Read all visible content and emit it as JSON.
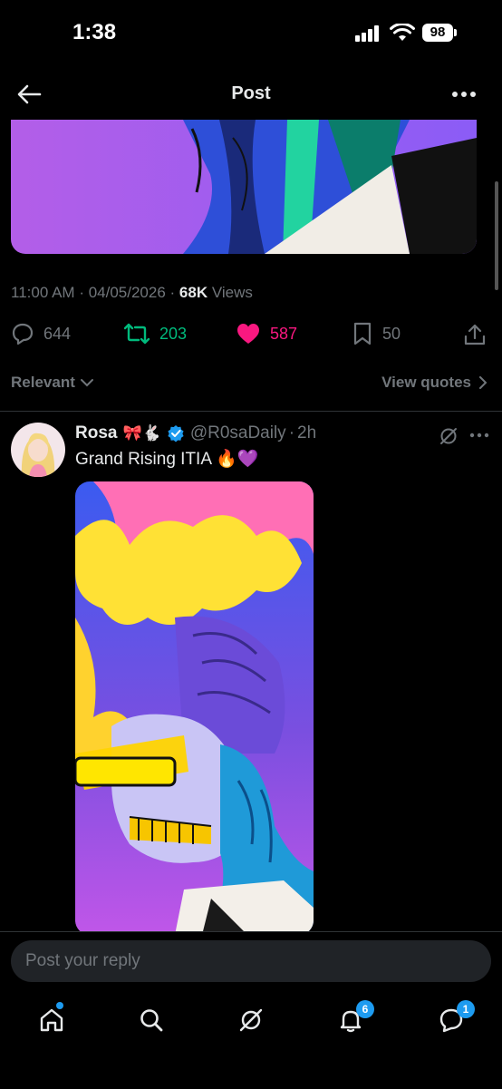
{
  "status_bar": {
    "time": "1:38",
    "battery": "98"
  },
  "header": {
    "title": "Post"
  },
  "post": {
    "time": "11:00 AM",
    "date": "04/05/2026",
    "views_count": "68K",
    "views_label": "Views",
    "actions": {
      "replies": "644",
      "reposts": "203",
      "likes": "587",
      "bookmarks": "50"
    }
  },
  "sort": {
    "label": "Relevant",
    "view_quotes": "View quotes"
  },
  "reply": {
    "name": "Rosa",
    "name_emoji": "🎀🐇",
    "handle": "@R0saDaily",
    "separator": "·",
    "time": "2h",
    "text": "Grand Rising ITIA 🔥💜"
  },
  "composer": {
    "placeholder": "Post your reply"
  },
  "bottom_nav": {
    "notifications_badge": "6",
    "messages_badge": "1"
  },
  "colors": {
    "accent": "#1d9bf0",
    "repost": "#00ba7c",
    "like": "#f91880",
    "muted": "#71767b"
  }
}
